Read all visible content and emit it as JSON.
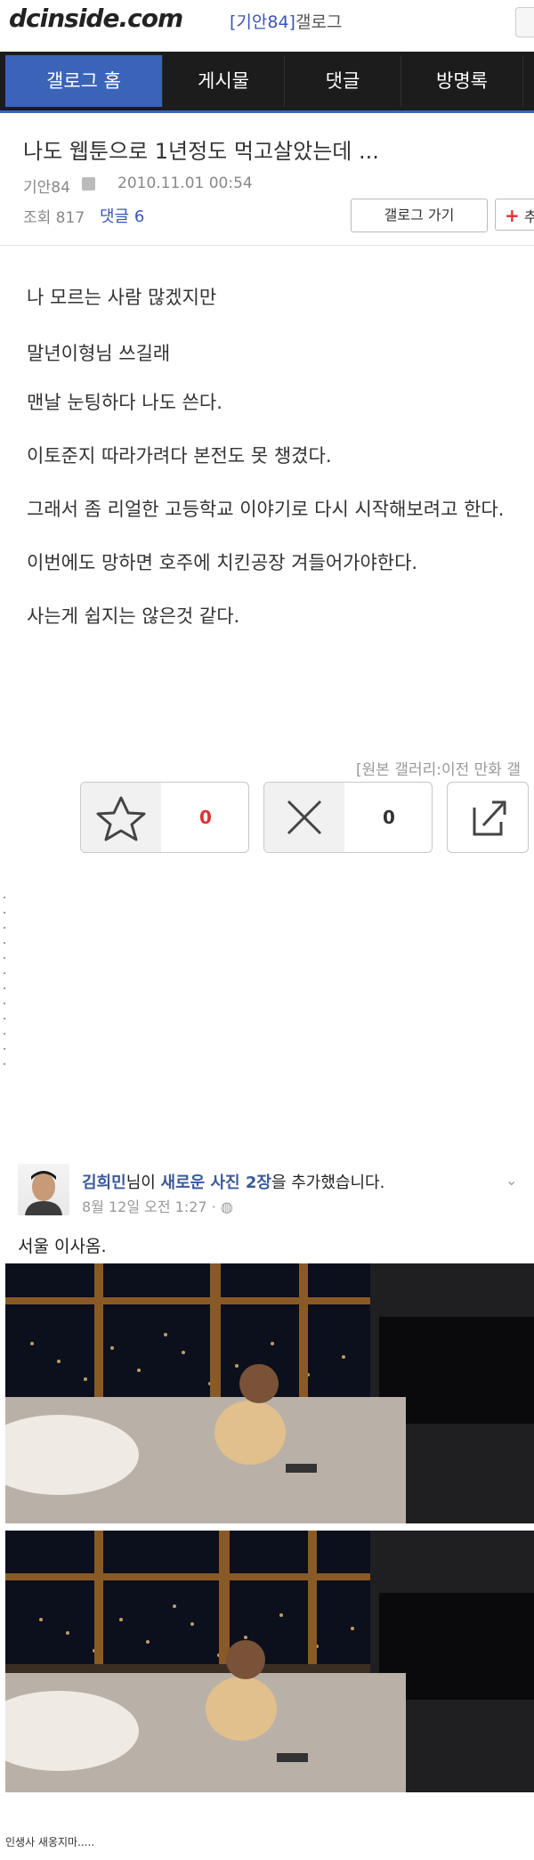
{
  "header": {
    "logo": "dcinside.com",
    "gallog_user": "[기안84]",
    "gallog_suffix": "갤로그"
  },
  "nav": {
    "tabs": [
      {
        "label": "갤로그 홈",
        "active": true
      },
      {
        "label": "게시물",
        "active": false
      },
      {
        "label": "댓글",
        "active": false
      },
      {
        "label": "방명록",
        "active": false
      }
    ]
  },
  "post": {
    "title": "나도 웹툰으로 1년정도 먹고살았는데 ...",
    "author": "기안84",
    "date": "2010.11.01 00:54",
    "views": "조회 817",
    "comments": "댓글 6",
    "gallog_go": "갤로그 가기",
    "add_label": "추",
    "body_lines": [
      "나 모르는 사람 많겠지만",
      "말년이형님 쓰길래",
      "맨날 눈팅하다 나도 쓴다.",
      "이토준지 따라가려다 본전도 못 챙겼다.",
      "그래서 좀 리얼한 고등학교 이야기로 다시 시작해보려고 한다.",
      "이번에도 망하면 호주에 치킨공장 겨들어가야한다.",
      "사는게 쉽지는 않은것 같다."
    ],
    "source": "[원본 갤러리:이전 만화 갤",
    "recommend_count": "0",
    "nonrecommend_count": "0"
  },
  "facebook": {
    "name": "김희민",
    "action_pre": "님이 ",
    "action_bold": "새로운 사진 2장",
    "action_post": "을 추가했습니다.",
    "time": "8월 12일 오전 1:27 · ",
    "caption": "서울 이사옴."
  },
  "bottom_caption": "인생사 새옹지마.....",
  "colors": {
    "accent": "#3b64b8",
    "nav_bg": "#1c1c1c",
    "link_blue": "#3a55b4",
    "recommend_red": "#d33"
  }
}
